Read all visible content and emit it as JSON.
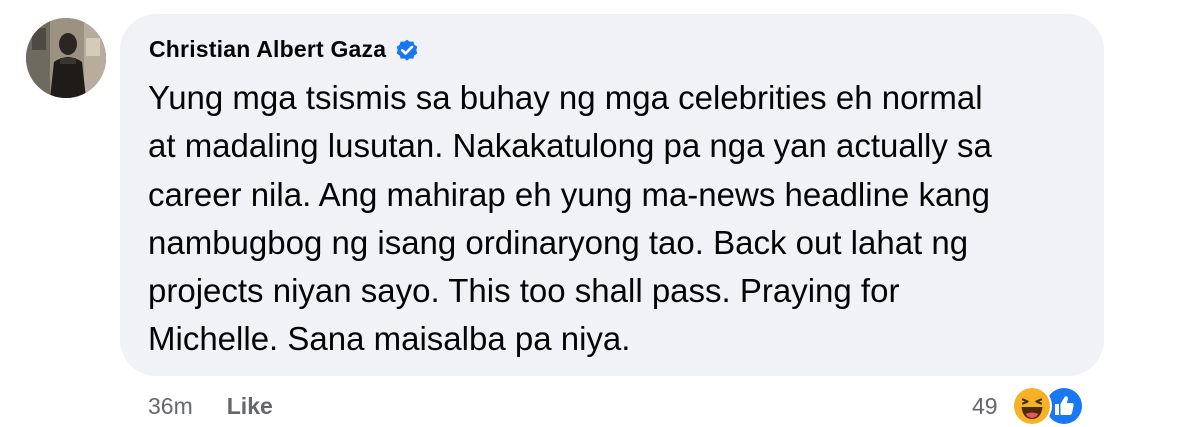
{
  "comment": {
    "author": "Christian Albert Gaza",
    "verified": true,
    "text_lines": [
      "Yung mga tsismis sa buhay ng mga celebrities eh normal",
      "at madaling lusutan. Nakakatulong pa nga yan actually sa",
      "career nila. Ang mahirap eh yung ma-news headline kang",
      "nambugbog ng isang ordinaryong tao. Back out lahat ng",
      "projects niyan sayo. This too shall pass. Praying for",
      "Michelle. Sana maisalba pa niya."
    ],
    "timestamp": "36m",
    "like_label": "Like",
    "reaction_count": "49",
    "reactions": [
      "haha-icon",
      "like-icon"
    ]
  },
  "colors": {
    "bubble": "#f0f2f5",
    "verified_blue": "#1877f2",
    "meta_text": "#65676b",
    "text": "#050505"
  }
}
